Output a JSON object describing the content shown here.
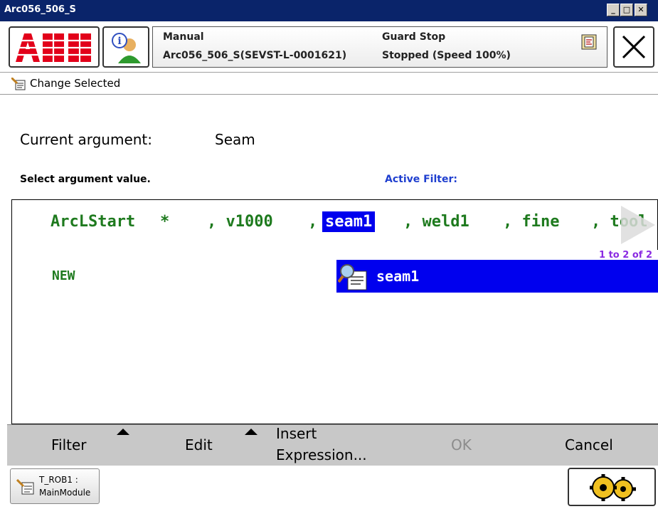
{
  "window": {
    "title": "Arc056_506_S"
  },
  "status": {
    "mode": "Manual",
    "system": "Arc056_506_S(SEVST-L-0001621)",
    "guard": "Guard Stop",
    "state": "Stopped (Speed 100%)"
  },
  "subheader": {
    "label": "Change Selected"
  },
  "argument": {
    "current_label": "Current argument:",
    "current_value": "Seam",
    "prompt": "Select argument value.",
    "filter_label": "Active Filter:"
  },
  "instruction": {
    "name": "ArcLStart",
    "star": "*",
    "arg_v": ", v1000",
    "comma1": ",",
    "selected": "seam1",
    "arg_weld": ", weld1",
    "arg_fine": ", fine",
    "arg_tool": ", tool"
  },
  "list": {
    "counter": "1 to 2 of 2",
    "new_item": "NEW",
    "items": [
      {
        "label": "seam1",
        "icon": "data-icon"
      }
    ]
  },
  "toolbar": {
    "filter": "Filter",
    "edit": "Edit",
    "insert_line1": "Insert",
    "insert_line2": "Expression...",
    "ok": "OK",
    "cancel": "Cancel"
  },
  "footer": {
    "task_line1": "T_ROB1 :",
    "task_line2": "MainModule"
  },
  "colors": {
    "code_green": "#1e7a1e",
    "selection_blue": "#0000ee",
    "filter_blue": "#1f3fcf",
    "abb_red": "#e2001a",
    "disabled_gray": "#8c8c8c"
  }
}
